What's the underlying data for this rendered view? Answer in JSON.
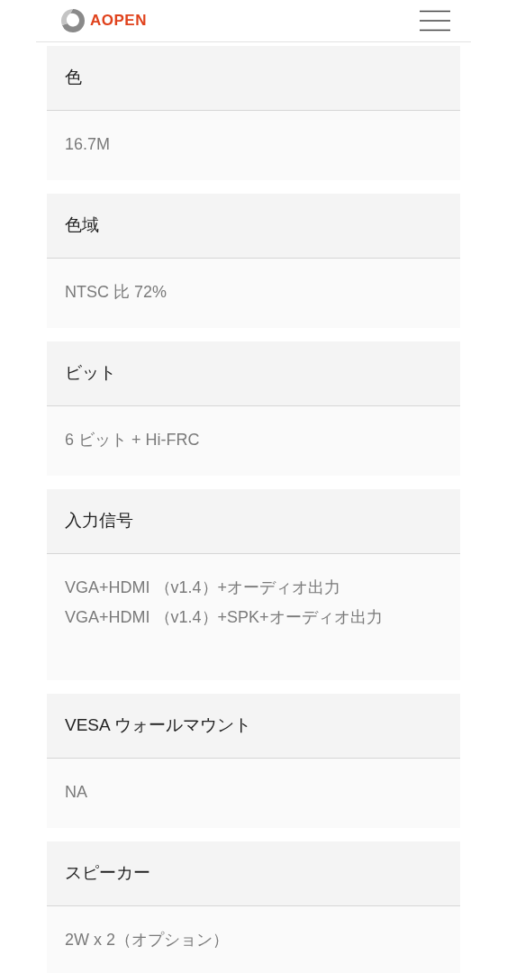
{
  "header": {
    "brand": "AOPEN"
  },
  "specs": [
    {
      "label": "色",
      "lines": [
        "16.7M"
      ]
    },
    {
      "label": "色域",
      "lines": [
        "NTSC 比 72%"
      ]
    },
    {
      "label": "ビット",
      "lines": [
        "6 ビット + Hi-FRC"
      ]
    },
    {
      "label": "入力信号",
      "lines": [
        "VGA+HDMI （v1.4）+オーディオ出力",
        "VGA+HDMI （v1.4）+SPK+オーディオ出力"
      ]
    },
    {
      "label": "VESA ウォールマウント",
      "lines": [
        "NA"
      ]
    },
    {
      "label": "スピーカー",
      "lines": [
        "2W x 2（オプション）"
      ]
    }
  ]
}
